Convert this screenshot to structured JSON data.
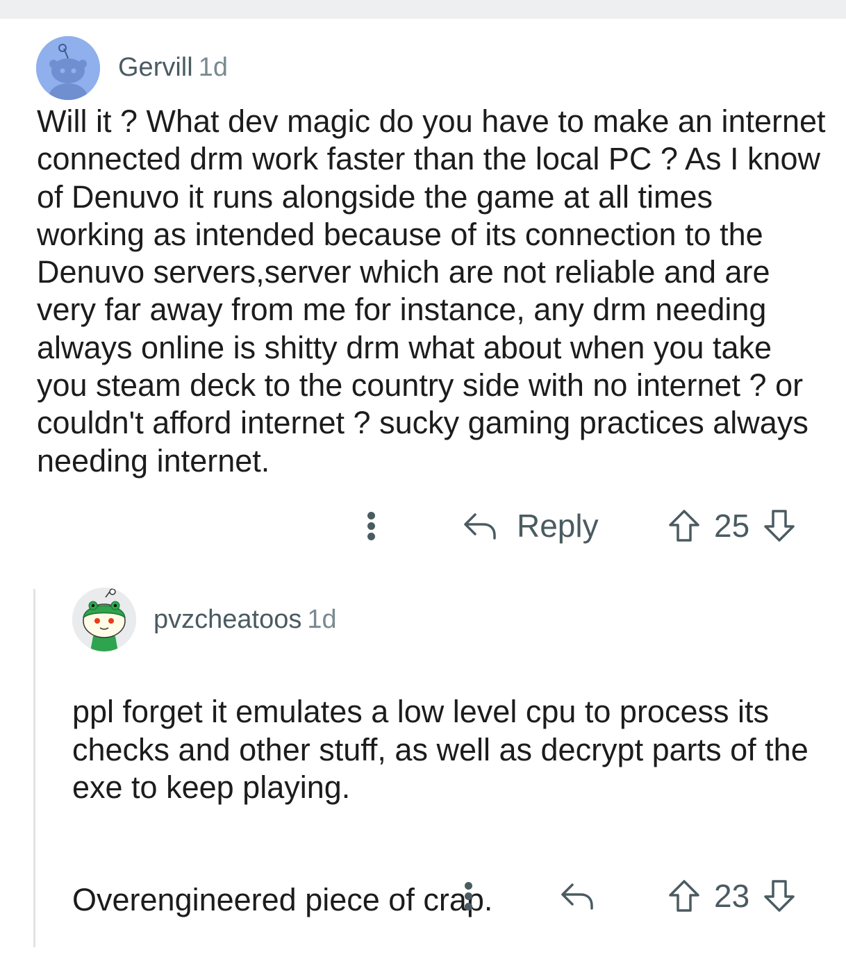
{
  "comments": [
    {
      "username": "Gervill",
      "age": "1d",
      "body": "Will it ? What dev magic do you have to make an internet connected drm work faster than the local PC ? As I know of Denuvo it runs alongside the game at all times working as intended because of its connection to the Denuvo servers,server which are not reliable and are very far away from me for instance, any drm needing always online is shitty drm what about when you take you steam deck to the country side with no internet ? or couldn't afford internet ? sucky gaming practices always needing internet.",
      "reply_label": "Reply",
      "score": "25",
      "avatar_color": "#8fb0ec"
    },
    {
      "username": "pvzcheatoos",
      "age": "1d",
      "paragraphs": [
        "ppl forget it emulates a low level cpu to process its checks and other stuff, as well as decrypt parts of the exe to keep playing.",
        "Overengineered piece of crap."
      ],
      "score": "23",
      "avatar_color": "#e9ebed"
    }
  ],
  "icons": {
    "more": "more-vertical-icon",
    "reply": "reply-arrow-icon",
    "upvote": "upvote-arrow-icon",
    "downvote": "downvote-arrow-icon"
  }
}
